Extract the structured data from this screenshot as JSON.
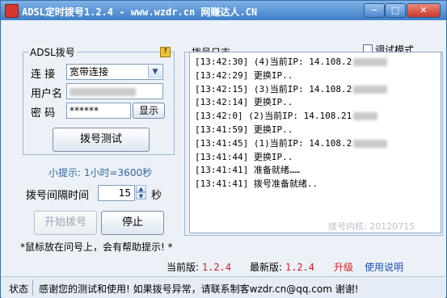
{
  "window": {
    "title": "ADSL定时拨号1.2.4 - www.wzdr.cn 网赚达人.CN",
    "minimize_glyph": "−",
    "maximize_glyph": "□",
    "close_glyph": "✕"
  },
  "adsl_group": {
    "legend": "ADSL拨号",
    "help_glyph": "?",
    "connection_label": "连  接",
    "connection_value": "宽带连接",
    "username_label": "用户名",
    "password_label": "密  码",
    "password_value": "******",
    "show_button": "显示",
    "test_button": "拨号测试"
  },
  "tip": "小提示: 1小时=3600秒",
  "interval": {
    "label": "拨号间隔时间",
    "value": "15",
    "unit": "秒"
  },
  "actions": {
    "start_button": "开始拨号",
    "stop_button": "停止"
  },
  "hint": "*鼠标放在问号上，会有帮助提示! *",
  "log_group": {
    "legend": "拨号日志",
    "debug_label": "调试模式",
    "lines": [
      "[13:42:30] (4)当前IP: 14.108.2",
      "[13:42:29] 更换IP..",
      "[13:42:15] (3)当前IP: 14.108.2",
      "[13:42:14] 更换IP..",
      "[13:42:0] (2)当前IP: 14.108.21",
      "[13:41:59] 更换IP..",
      "[13:41:45] (1)当前IP: 14.108.2",
      "[13:41:44] 更换IP..",
      "[13:41:41] 准备就绪……",
      "[13:41:41] 拨号准备就绪.."
    ],
    "kernel": "拨号内核: 20120715"
  },
  "version": {
    "current_label": "当前版:",
    "current_value": "1.2.4",
    "latest_label": "最新版:",
    "latest_value": "1.2.4",
    "upgrade_link": "升级",
    "help_link": "使用说明"
  },
  "status": {
    "caption": "状态",
    "text": "感谢您的测试和使用! 如果拨号异常，请联系制客wzdr.cn@qq.com 谢谢!"
  },
  "colors": {
    "titlebar": "#3f7fc8",
    "accent_red": "#d02020",
    "link_blue": "#1a4fb3",
    "tip_blue": "#336699"
  }
}
